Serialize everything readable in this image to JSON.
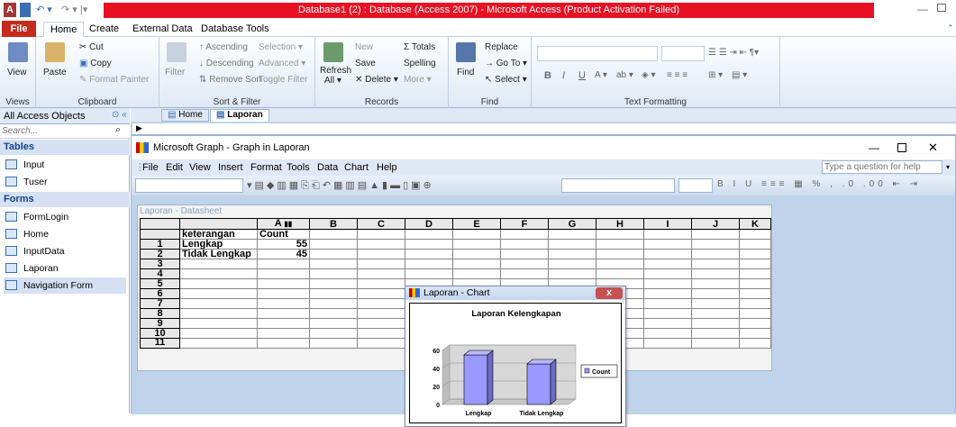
{
  "app": {
    "title": "Database1 (2) : Database (Access 2007) - Microsoft Access (Product Activation Failed)",
    "qat_icon": "access-icon"
  },
  "menu": {
    "file": "File",
    "tabs": [
      "Home",
      "Create",
      "External Data",
      "Database Tools"
    ]
  },
  "ribbon": {
    "views": {
      "label": "Views",
      "view": "View"
    },
    "clipboard": {
      "label": "Clipboard",
      "paste": "Paste",
      "cut": "Cut",
      "copy": "Copy",
      "format_painter": "Format Painter"
    },
    "sort": {
      "label": "Sort & Filter",
      "filter": "Filter",
      "ascending": "Ascending",
      "descending": "Descending",
      "remove_sort": "Remove Sort",
      "selection": "Selection",
      "advanced": "Advanced",
      "toggle_filter": "Toggle Filter"
    },
    "records": {
      "label": "Records",
      "refresh": "Refresh",
      "all": "All",
      "new": "New",
      "save": "Save",
      "delete": "Delete",
      "totals": "Totals",
      "spelling": "Spelling",
      "more": "More"
    },
    "find": {
      "label": "Find",
      "find": "Find",
      "replace": "Replace",
      "goto": "Go To",
      "select": "Select"
    },
    "text": {
      "label": "Text Formatting"
    }
  },
  "nav": {
    "header": "All Access Objects",
    "search_placeholder": "Search...",
    "tables_header": "Tables",
    "tables": [
      "Input",
      "Tuser"
    ],
    "forms_header": "Forms",
    "forms": [
      "FormLogin",
      "Home",
      "InputData",
      "Laporan",
      "Navigation Form"
    ]
  },
  "doc_tabs": [
    "Home",
    "Laporan"
  ],
  "graph": {
    "title": "Microsoft Graph - Graph in Laporan",
    "menu": [
      "File",
      "Edit",
      "View",
      "Insert",
      "Format",
      "Tools",
      "Data",
      "Chart",
      "Help"
    ],
    "help_placeholder": "Type a question for help"
  },
  "datasheet": {
    "title": "Laporan - Datasheet",
    "columns": [
      "A",
      "B",
      "C",
      "D",
      "E",
      "F",
      "G",
      "H",
      "I",
      "J",
      "K"
    ],
    "rows": [
      "1",
      "2",
      "3",
      "4",
      "5",
      "6",
      "7",
      "8",
      "9",
      "10",
      "11"
    ],
    "header_row": {
      "label": "keterangan",
      "A": "Count"
    },
    "data": [
      {
        "label": "Lengkap",
        "A": "55"
      },
      {
        "label": "Tidak Lengkap",
        "A": "45"
      }
    ]
  },
  "chartwin": {
    "title": "Laporan - Chart",
    "close": "x"
  },
  "chart_data": {
    "type": "bar",
    "title": "Laporan Kelengkapan",
    "categories": [
      "Lengkap",
      "Tidak Lengkap"
    ],
    "series": [
      {
        "name": "Count",
        "values": [
          55,
          45
        ]
      }
    ],
    "yticks": [
      "60",
      "40",
      "20",
      "0"
    ],
    "ylim": [
      0,
      60
    ],
    "color": "#9999ff"
  }
}
